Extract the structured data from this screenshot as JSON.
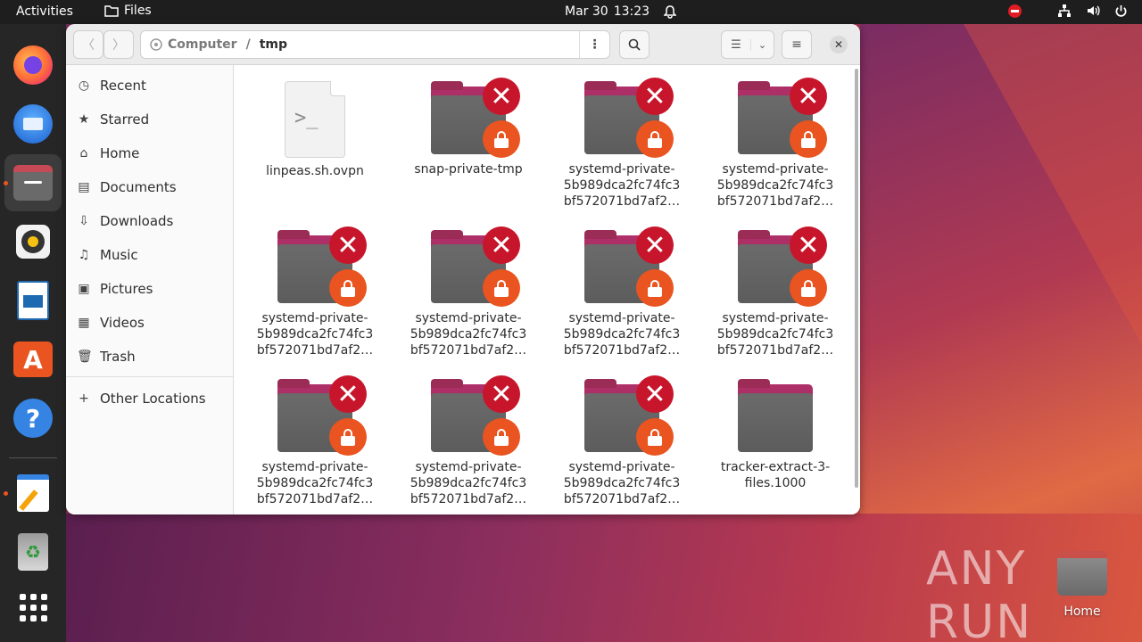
{
  "topbar": {
    "activities": "Activities",
    "app_name": "Files",
    "date": "Mar 30",
    "time": "13:23"
  },
  "dock": {
    "items": [
      "firefox-icon",
      "thunderbird-icon",
      "files-icon",
      "rhythmbox-icon",
      "libreoffice-writer-icon",
      "app-center-icon",
      "help-icon",
      "text-editor-icon",
      "trash-icon",
      "show-apps-icon"
    ]
  },
  "window": {
    "path": {
      "root": "Computer",
      "separator": "/",
      "current": "tmp"
    }
  },
  "sidebar": {
    "items": [
      {
        "label": "Recent",
        "icon": "clock-icon"
      },
      {
        "label": "Starred",
        "icon": "star-icon"
      },
      {
        "label": "Home",
        "icon": "home-icon"
      },
      {
        "label": "Documents",
        "icon": "document-icon"
      },
      {
        "label": "Downloads",
        "icon": "download-icon"
      },
      {
        "label": "Music",
        "icon": "music-icon"
      },
      {
        "label": "Pictures",
        "icon": "picture-icon"
      },
      {
        "label": "Videos",
        "icon": "video-icon"
      },
      {
        "label": "Trash",
        "icon": "trash-icon"
      }
    ],
    "other": "Other Locations"
  },
  "files": [
    {
      "name": "linpeas.sh.ovpn",
      "line2": "",
      "line3": "",
      "kind": "script"
    },
    {
      "name": "snap-private-tmp",
      "line2": "",
      "line3": "",
      "kind": "locked"
    },
    {
      "name": "systemd-private-",
      "line2": "5b989dca2fc74fc3",
      "line3": "bf572071bd7af2…",
      "kind": "locked"
    },
    {
      "name": "systemd-private-",
      "line2": "5b989dca2fc74fc3",
      "line3": "bf572071bd7af2…",
      "kind": "locked"
    },
    {
      "name": "systemd-private-",
      "line2": "5b989dca2fc74fc3",
      "line3": "bf572071bd7af2…",
      "kind": "locked"
    },
    {
      "name": "systemd-private-",
      "line2": "5b989dca2fc74fc3",
      "line3": "bf572071bd7af2…",
      "kind": "locked"
    },
    {
      "name": "systemd-private-",
      "line2": "5b989dca2fc74fc3",
      "line3": "bf572071bd7af2…",
      "kind": "locked"
    },
    {
      "name": "systemd-private-",
      "line2": "5b989dca2fc74fc3",
      "line3": "bf572071bd7af2…",
      "kind": "locked"
    },
    {
      "name": "systemd-private-",
      "line2": "5b989dca2fc74fc3",
      "line3": "bf572071bd7af2…",
      "kind": "locked"
    },
    {
      "name": "systemd-private-",
      "line2": "5b989dca2fc74fc3",
      "line3": "bf572071bd7af2…",
      "kind": "locked"
    },
    {
      "name": "systemd-private-",
      "line2": "5b989dca2fc74fc3",
      "line3": "bf572071bd7af2…",
      "kind": "locked"
    },
    {
      "name": "tracker-extract-3-",
      "line2": "files.1000",
      "line3": "",
      "kind": "folder"
    }
  ],
  "desktop": {
    "home_label": "Home",
    "watermark": "ANY RUN"
  }
}
